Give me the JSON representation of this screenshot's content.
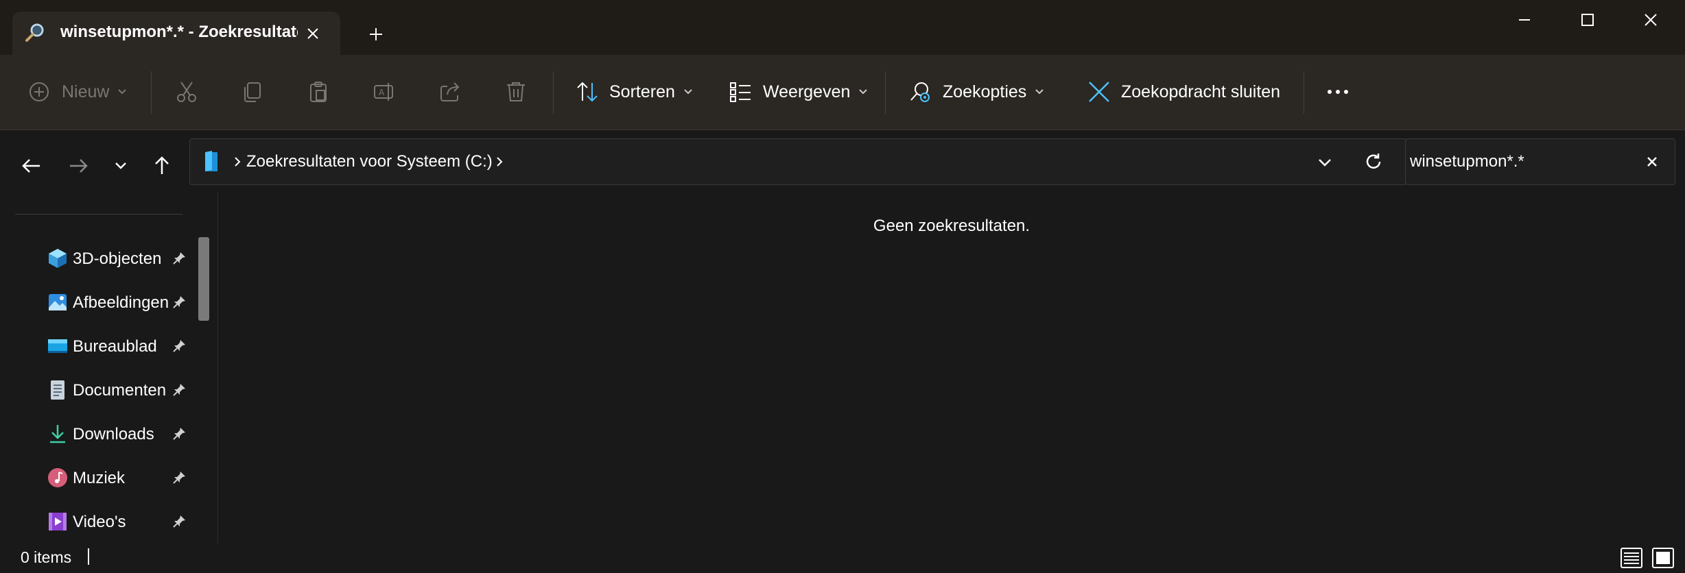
{
  "window": {
    "tab_title": "winsetupmon*.* - Zoekresultaten in Systeem (C:)",
    "tab_icon": "search-icon",
    "new_tab_icon": "plus-icon",
    "controls": [
      "minimize-icon",
      "maximize-icon",
      "close-icon"
    ]
  },
  "toolbar": {
    "new_label": "Nieuw",
    "sort_label": "Sorteren",
    "view_label": "Weergeven",
    "search_options_label": "Zoekopties",
    "close_search_label": "Zoekopdracht sluiten",
    "disabled_actions": [
      "cut-icon",
      "copy-icon",
      "paste-icon",
      "rename-icon",
      "share-icon",
      "delete-icon"
    ],
    "more_icon": "more-icon"
  },
  "address": {
    "location": "Zoekresultaten voor Systeem (C:)"
  },
  "search": {
    "value": "winsetupmon*.*"
  },
  "sidebar": {
    "items": [
      {
        "label": "3D-objecten",
        "icon": "3d-objects-icon",
        "pinned": true
      },
      {
        "label": "Afbeeldingen",
        "icon": "pictures-icon",
        "pinned": true
      },
      {
        "label": "Bureaublad",
        "icon": "desktop-icon",
        "pinned": true
      },
      {
        "label": "Documenten",
        "icon": "documents-icon",
        "pinned": true
      },
      {
        "label": "Downloads",
        "icon": "downloads-icon",
        "pinned": true
      },
      {
        "label": "Muziek",
        "icon": "music-icon",
        "pinned": true
      },
      {
        "label": "Video's",
        "icon": "videos-icon",
        "pinned": true
      }
    ]
  },
  "content": {
    "empty_message": "Geen zoekresultaten."
  },
  "status": {
    "item_count": "0 items"
  },
  "colors": {
    "accent_blue": "#4cc2ff",
    "titlebar_bg": "#1f1b17",
    "commandbar_bg": "#2b2723",
    "window_bg": "#191919"
  }
}
